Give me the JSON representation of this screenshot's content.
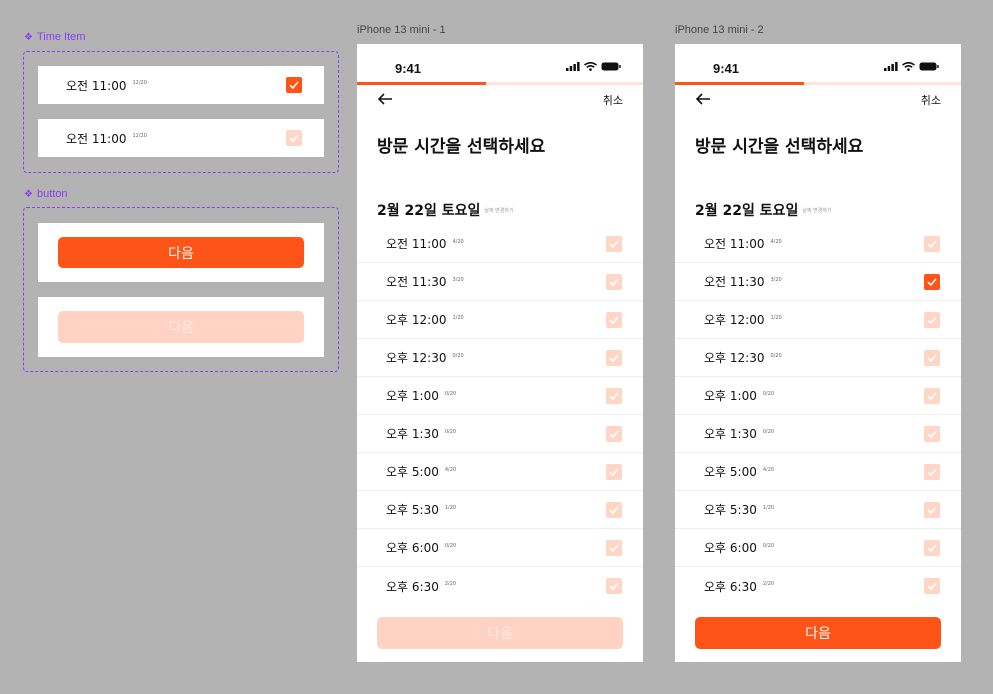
{
  "components": {
    "time_item_label": "Time Item",
    "button_label": "button",
    "time_items": [
      {
        "time": "오전 11:00",
        "count": "12/20",
        "checked": true
      },
      {
        "time": "오전 11:00",
        "count": "12/20",
        "checked": false
      }
    ],
    "buttons": [
      {
        "label": "다음",
        "state": "active"
      },
      {
        "label": "다음",
        "state": "disabled"
      }
    ]
  },
  "frames": [
    {
      "title": "iPhone 13 mini - 1",
      "status_time": "9:41",
      "progress": 0.45,
      "back_icon": "arrow-left-icon",
      "cancel_label": "취소",
      "heading": "방문 시간을 선택하세요",
      "date": "2월 22일 토요일",
      "date_sub": "날짜 변경하기",
      "slots": [
        {
          "time": "오전 11:00",
          "count": "4/20",
          "checked": false
        },
        {
          "time": "오전 11:30",
          "count": "3/20",
          "checked": false
        },
        {
          "time": "오후 12:00",
          "count": "1/20",
          "checked": false
        },
        {
          "time": "오후 12:30",
          "count": "0/20",
          "checked": false
        },
        {
          "time": "오후 1:00",
          "count": "0/20",
          "checked": false
        },
        {
          "time": "오후 1:30",
          "count": "0/20",
          "checked": false
        },
        {
          "time": "오후 5:00",
          "count": "4/20",
          "checked": false
        },
        {
          "time": "오후 5:30",
          "count": "1/20",
          "checked": false
        },
        {
          "time": "오후 6:00",
          "count": "0/20",
          "checked": false
        },
        {
          "time": "오후 6:30",
          "count": "2/20",
          "checked": false
        }
      ],
      "next_label": "다음",
      "next_state": "disabled"
    },
    {
      "title": "iPhone 13 mini - 2",
      "status_time": "9:41",
      "progress": 0.45,
      "back_icon": "arrow-left-icon",
      "cancel_label": "취소",
      "heading": "방문 시간을 선택하세요",
      "date": "2월 22일 토요일",
      "date_sub": "날짜 변경하기",
      "slots": [
        {
          "time": "오전 11:00",
          "count": "4/20",
          "checked": false
        },
        {
          "time": "오전 11:30",
          "count": "3/20",
          "checked": true
        },
        {
          "time": "오후 12:00",
          "count": "1/20",
          "checked": false
        },
        {
          "time": "오후 12:30",
          "count": "0/20",
          "checked": false
        },
        {
          "time": "오후 1:00",
          "count": "0/20",
          "checked": false
        },
        {
          "time": "오후 1:30",
          "count": "0/20",
          "checked": false
        },
        {
          "time": "오후 5:00",
          "count": "4/20",
          "checked": false
        },
        {
          "time": "오후 5:30",
          "count": "1/20",
          "checked": false
        },
        {
          "time": "오후 6:00",
          "count": "0/20",
          "checked": false
        },
        {
          "time": "오후 6:30",
          "count": "2/20",
          "checked": false
        }
      ],
      "next_label": "다음",
      "next_state": "active"
    }
  ],
  "colors": {
    "accent": "#ff5417",
    "accent_light": "#ffd6c6",
    "component_outline": "#8a3ff0",
    "canvas": "#b3b3b3"
  }
}
